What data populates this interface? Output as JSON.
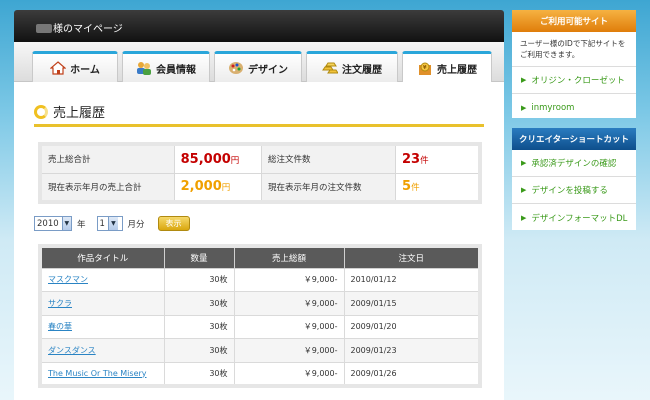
{
  "header": {
    "title": "様のマイページ"
  },
  "tabs": [
    {
      "label": "ホーム",
      "icon": "home-icon"
    },
    {
      "label": "会員情報",
      "icon": "members-icon"
    },
    {
      "label": "デザイン",
      "icon": "palette-icon"
    },
    {
      "label": "注文履歴",
      "icon": "gold-bars-icon"
    },
    {
      "label": "売上履歴",
      "icon": "sales-icon",
      "active": true
    }
  ],
  "page": {
    "title": "売上履歴"
  },
  "summary": {
    "total_label": "売上総合計",
    "total_value": "85,000",
    "total_unit": "円",
    "orders_label": "総注文件数",
    "orders_value": "23",
    "orders_unit": "件",
    "month_sales_label": "現在表示年月の売上合計",
    "month_sales_value": "2,000",
    "month_sales_unit": "円",
    "month_orders_label": "現在表示年月の注文件数",
    "month_orders_value": "5",
    "month_orders_unit": "件"
  },
  "filter": {
    "year": "2010",
    "year_unit": "年",
    "month": "1",
    "month_unit": "月分",
    "button": "表示"
  },
  "table": {
    "headers": [
      "作品タイトル",
      "数量",
      "売上総額",
      "注文日"
    ],
    "rows": [
      {
        "title": "マスクマン",
        "qty": "30枚",
        "amount": "￥9,000-",
        "date": "2010/01/12"
      },
      {
        "title": "サクラ",
        "qty": "30枚",
        "amount": "￥9,000-",
        "date": "2009/01/15"
      },
      {
        "title": "春の華",
        "qty": "30枚",
        "amount": "￥9,000-",
        "date": "2009/01/20"
      },
      {
        "title": "ダンスダンス",
        "qty": "30枚",
        "amount": "￥9,000-",
        "date": "2009/01/23"
      },
      {
        "title": "The Music Or The Misery",
        "qty": "30枚",
        "amount": "￥9,000-",
        "date": "2009/01/26"
      }
    ]
  },
  "sidebar": {
    "sites": {
      "title": "ご利用可能サイト",
      "desc": "ユーザー様のIDで下記サイトをご利用できます。",
      "links": [
        "オリジン・クローゼット",
        "inmyroom"
      ]
    },
    "shortcuts": {
      "title": "クリエイターショートカット",
      "links": [
        "承認済デザインの確認",
        "デザインを投稿する",
        "デザインフォーマットDL"
      ]
    }
  },
  "colors": {
    "accent_blue": "#2aa6da",
    "title_yellow": "#e9c12c",
    "value_red": "#c40000",
    "value_orange": "#f0a000",
    "link_green": "#3a9a1a"
  }
}
